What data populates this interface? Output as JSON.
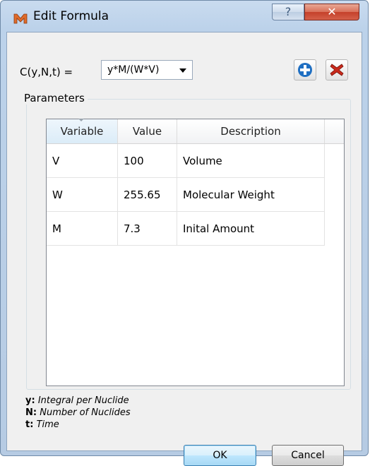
{
  "window": {
    "title": "Edit Formula"
  },
  "titlebar_buttons": {
    "help": "?",
    "close": "✕"
  },
  "formula": {
    "label": "C(y,N,t) =",
    "selected": "y*M/(W*V)"
  },
  "parameters": {
    "group_title": "Parameters",
    "columns": [
      "Variable",
      "Value",
      "Description"
    ],
    "rows": [
      {
        "variable": "V",
        "value": "100",
        "description": "Volume"
      },
      {
        "variable": "W",
        "value": "255.65",
        "description": "Molecular Weight"
      },
      {
        "variable": "M",
        "value": "7.3",
        "description": "Inital Amount"
      }
    ]
  },
  "legend": [
    {
      "symbol": "y:",
      "meaning": "Integral per Nuclide"
    },
    {
      "symbol": "N:",
      "meaning": "Number of Nuclides"
    },
    {
      "symbol": "t:",
      "meaning": "Time"
    }
  ],
  "buttons": {
    "ok": "OK",
    "cancel": "Cancel"
  },
  "icons": {
    "add": "plus-icon",
    "remove": "x-icon",
    "app": "m-app-icon"
  },
  "colors": {
    "add_icon": "#1f6fc2",
    "remove_icon": "#c8291b"
  }
}
